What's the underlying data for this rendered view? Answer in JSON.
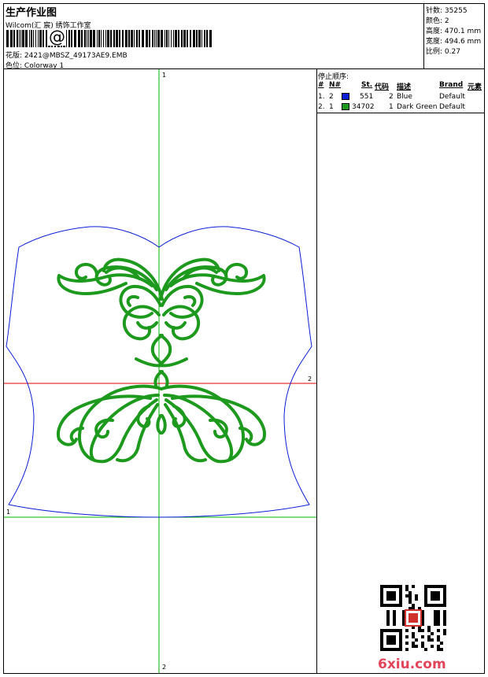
{
  "header": {
    "title": "生产作业图",
    "studio": "Wilcom(汇 宸) 绣饰工作室",
    "barcode_symbol": "@",
    "design_file_label": "花版:",
    "design_file": "2421@MBSZ_49173AE9.EMB",
    "colorway_label": "色位:",
    "colorway": "Colorway 1"
  },
  "stats": {
    "stitches_label": "针数:",
    "stitches": "35255",
    "colors_label": "颜色:",
    "colors": "2",
    "height_label": "高度:",
    "height": "470.1 mm",
    "width_label": "宽度:",
    "width": "494.6 mm",
    "scale_label": "比例:",
    "scale": "0.27"
  },
  "stop_sequence": {
    "title": "停止顺序:",
    "headers": {
      "seq": "#",
      "needle": "N#",
      "stitches": "St.",
      "code": "代码",
      "description": "描述",
      "brand": "Brand",
      "element": "元素"
    },
    "rows": [
      {
        "seq": "1.",
        "needle": "2",
        "swatch_color": "#0a1fd6",
        "stitches": "551",
        "code": "2",
        "description": "Blue",
        "brand": "Default"
      },
      {
        "seq": "2.",
        "needle": "1",
        "swatch_color": "#1d9a1d",
        "stitches": "34702",
        "code": "1",
        "description": "Dark Green",
        "brand": "Default"
      }
    ]
  },
  "canvas": {
    "axis_label_top": "1",
    "axis_label_bottom": "2",
    "axis_label_left": "1",
    "axis_label_right": "2",
    "vertical_axis_color": "#00b400",
    "horizontal_axis_color": "#e00000",
    "lower_axis_color": "#00b400",
    "outline_color": "#0a1fd6",
    "embroidery_color": "#1d9a1d"
  },
  "watermark": {
    "logo_text": "6xiu.com",
    "logo_color": "#e2445a"
  }
}
